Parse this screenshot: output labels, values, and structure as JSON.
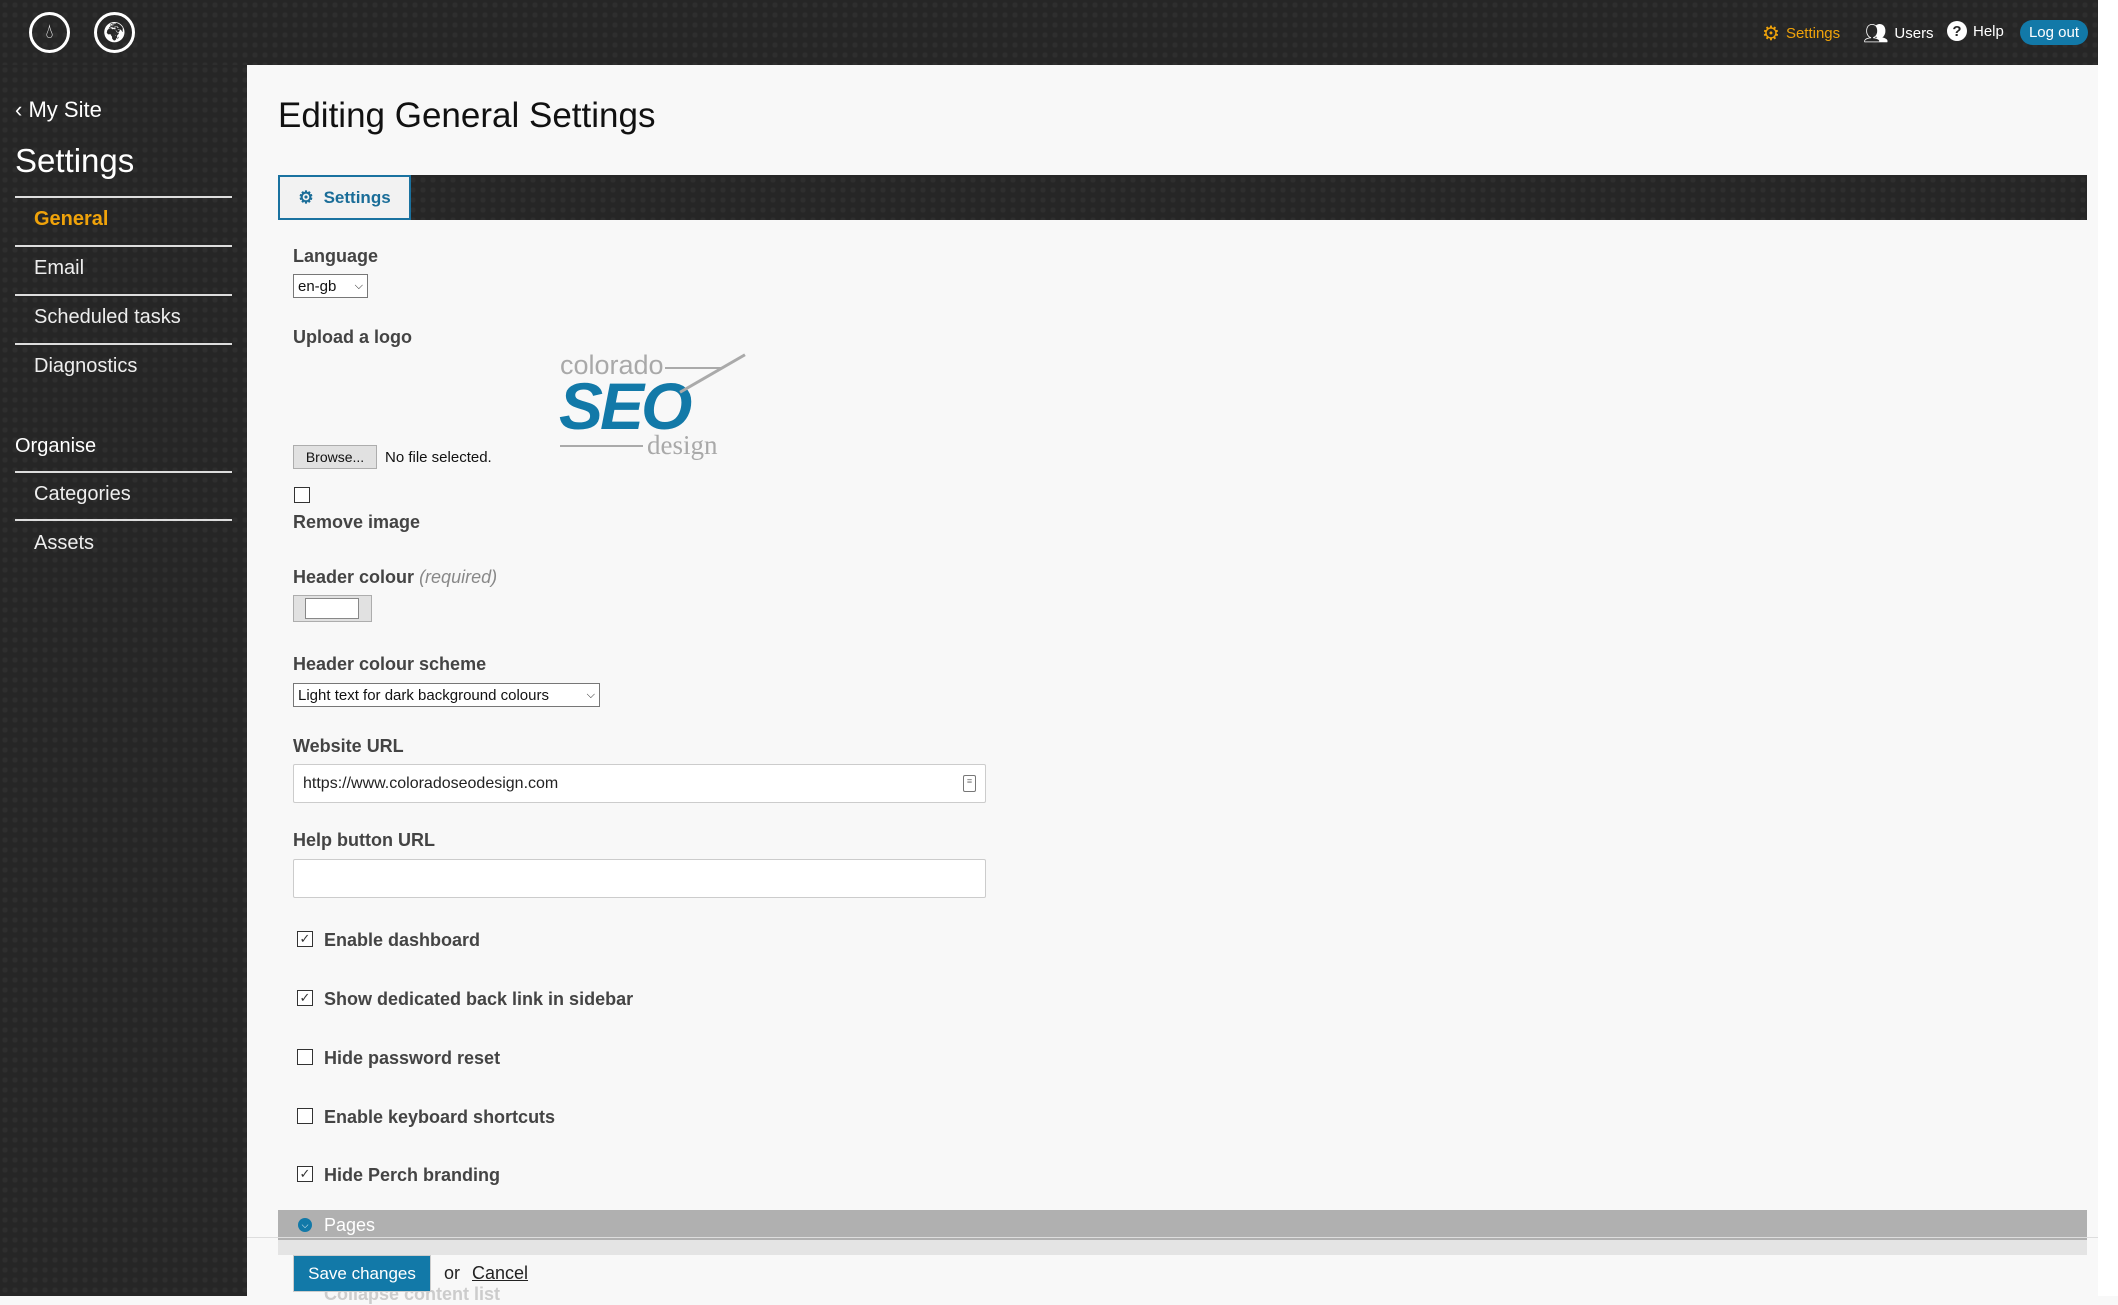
{
  "topbar": {
    "icons": [
      "dashboard-gauge-icon",
      "globe-icon"
    ],
    "nav": [
      {
        "label": "Settings",
        "icon": "gear-icon",
        "active": true
      },
      {
        "label": "Users",
        "icon": "users-icon"
      },
      {
        "label": "Help",
        "icon": "question-circle-icon"
      }
    ],
    "logout": "Log out"
  },
  "sidebar": {
    "back": "My Site",
    "title": "Settings",
    "items": [
      "General",
      "Email",
      "Scheduled tasks",
      "Diagnostics"
    ],
    "section": "Organise",
    "organise_items": [
      "Categories",
      "Assets"
    ],
    "active_color": "#f0a30a"
  },
  "main": {
    "title": "Editing General Settings",
    "tab": "Settings",
    "language": {
      "label": "Language",
      "value": "en-gb"
    },
    "logo": {
      "label": "Upload a logo",
      "browse": "Browse...",
      "file_status": "No file selected.",
      "logo_text_top": "colorado",
      "logo_text_mid": "SEO",
      "logo_text_bottom": "design"
    },
    "remove_image": {
      "label": "Remove image",
      "checked": false
    },
    "header_colour": {
      "label": "Header colour",
      "required": "(required)",
      "value": "#ffffff"
    },
    "scheme": {
      "label": "Header colour scheme",
      "value": "Light text for dark background colours"
    },
    "website_url": {
      "label": "Website URL",
      "value": "https://www.coloradoseodesign.com"
    },
    "help_url": {
      "label": "Help button URL",
      "value": ""
    },
    "checkboxes": [
      {
        "label": "Enable dashboard",
        "checked": true
      },
      {
        "label": "Show dedicated back link in sidebar",
        "checked": true
      },
      {
        "label": "Hide password reset",
        "checked": false
      },
      {
        "label": "Enable keyboard shortcuts",
        "checked": false
      },
      {
        "label": "Hide Perch branding",
        "checked": true
      }
    ],
    "section": "Pages",
    "ghost_item": "Collapse content list",
    "save": "Save changes",
    "or": "or",
    "cancel": "Cancel",
    "accent": "#1279a8"
  }
}
